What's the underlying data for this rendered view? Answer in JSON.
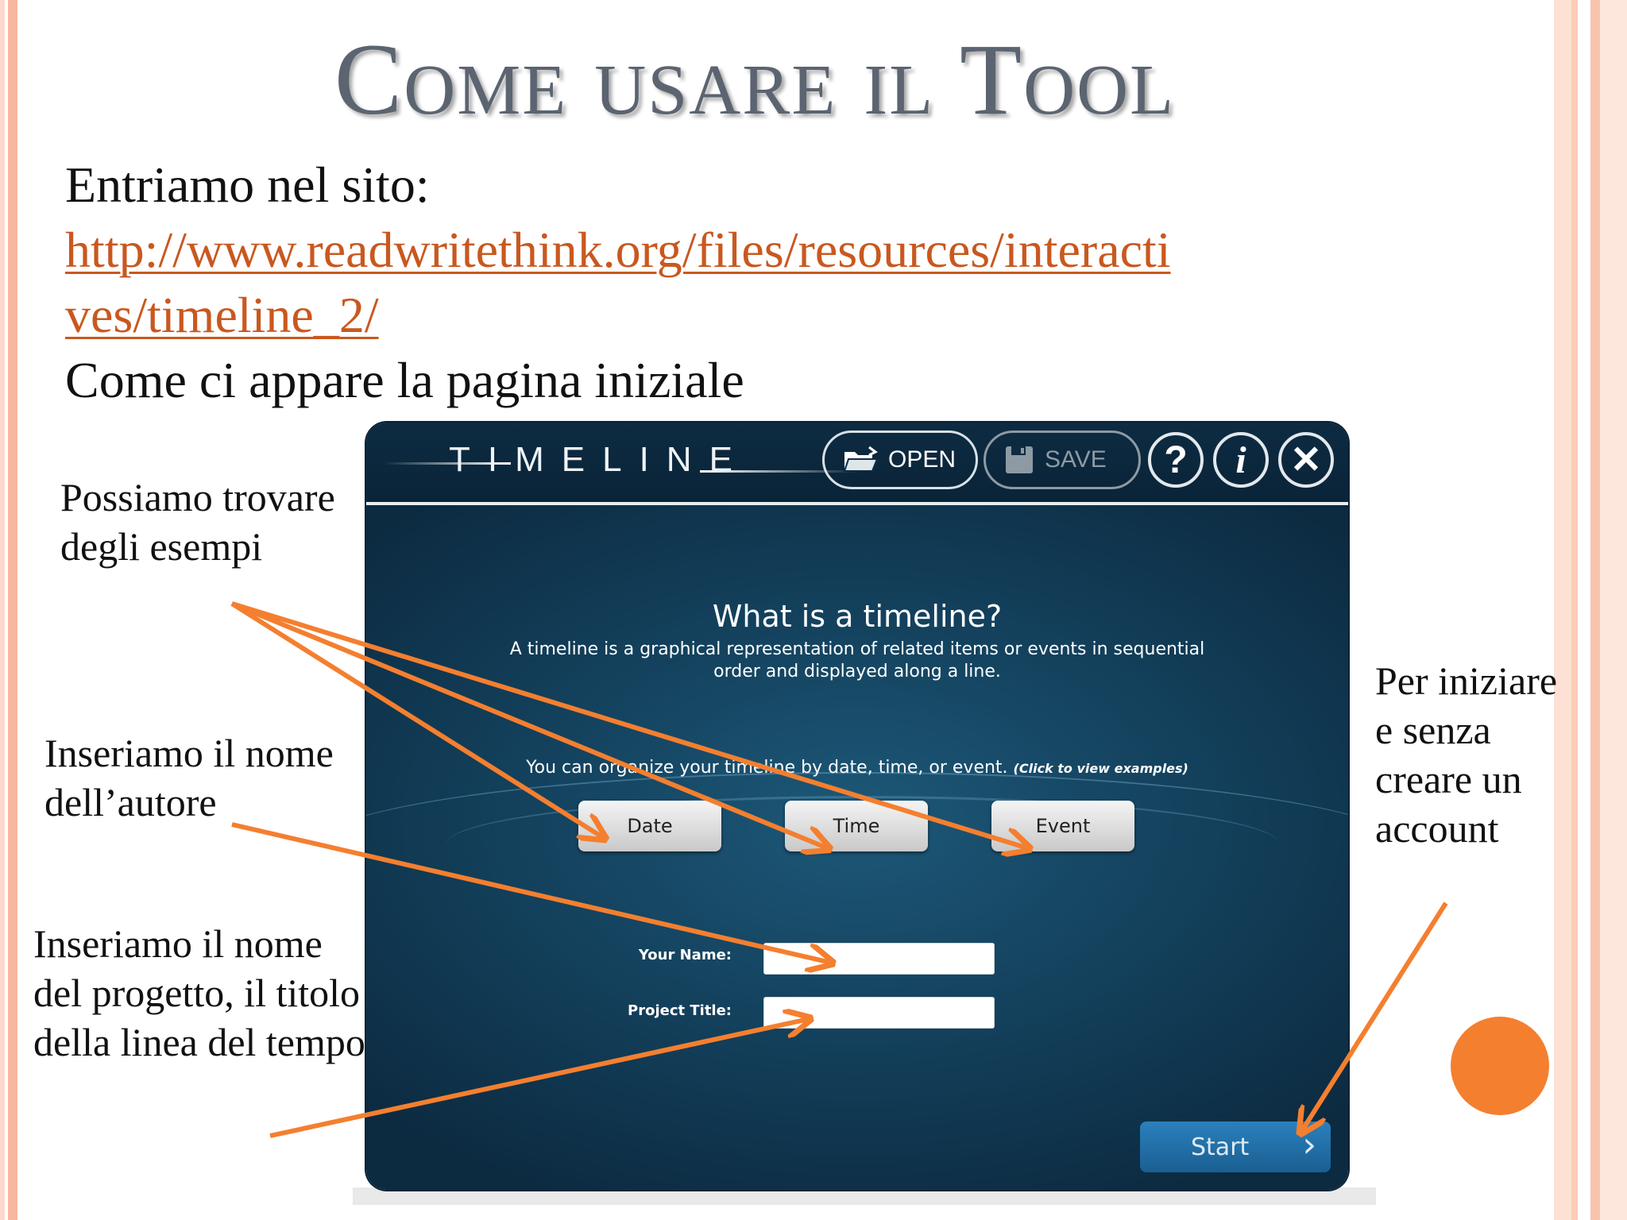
{
  "slide": {
    "title": "Come usare il Tool",
    "intro": "Entriamo nel sito:",
    "url_line_1": "http://www.readwritethink.org/files/resources/interacti",
    "url_line_2": "ves/timeline_2/",
    "caption": "Come ci appare la pagina iniziale"
  },
  "notes": {
    "examples": "Possiamo trovare degli esempi",
    "author": "Inseriamo il nome dell’autore",
    "project": "Inseriamo il nome del progetto, il titolo della linea del tempo",
    "start": "Per iniziare e senza creare un account"
  },
  "app": {
    "logo": "TIMELINE",
    "open_label": "OPEN",
    "save_label": "SAVE",
    "help_label": "?",
    "info_label": "i",
    "close_label": "✕",
    "heading": "What is a timeline?",
    "description": "A timeline is a graphical representation of related items or events in sequential order and displayed along a line.",
    "organize_text": "You can organize your timeline by date, time, or event.",
    "organize_hint": "(Click to view examples)",
    "buttons": {
      "date": "Date",
      "time": "Time",
      "event": "Event"
    },
    "name_label": "Your Name:",
    "title_label": "Project Title:",
    "start_label": "Start",
    "start_chevron": "›"
  },
  "icons": {
    "open": "folder-open-icon",
    "save": "floppy-disk-icon",
    "help": "question-icon",
    "info": "info-icon",
    "close": "close-icon",
    "start": "chevron-right-icon"
  },
  "colors": {
    "accent": "#f47f2f",
    "link": "#c9581f",
    "title": "#5b6470",
    "app_background": "#14435f",
    "start_button": "#2b80bd"
  }
}
